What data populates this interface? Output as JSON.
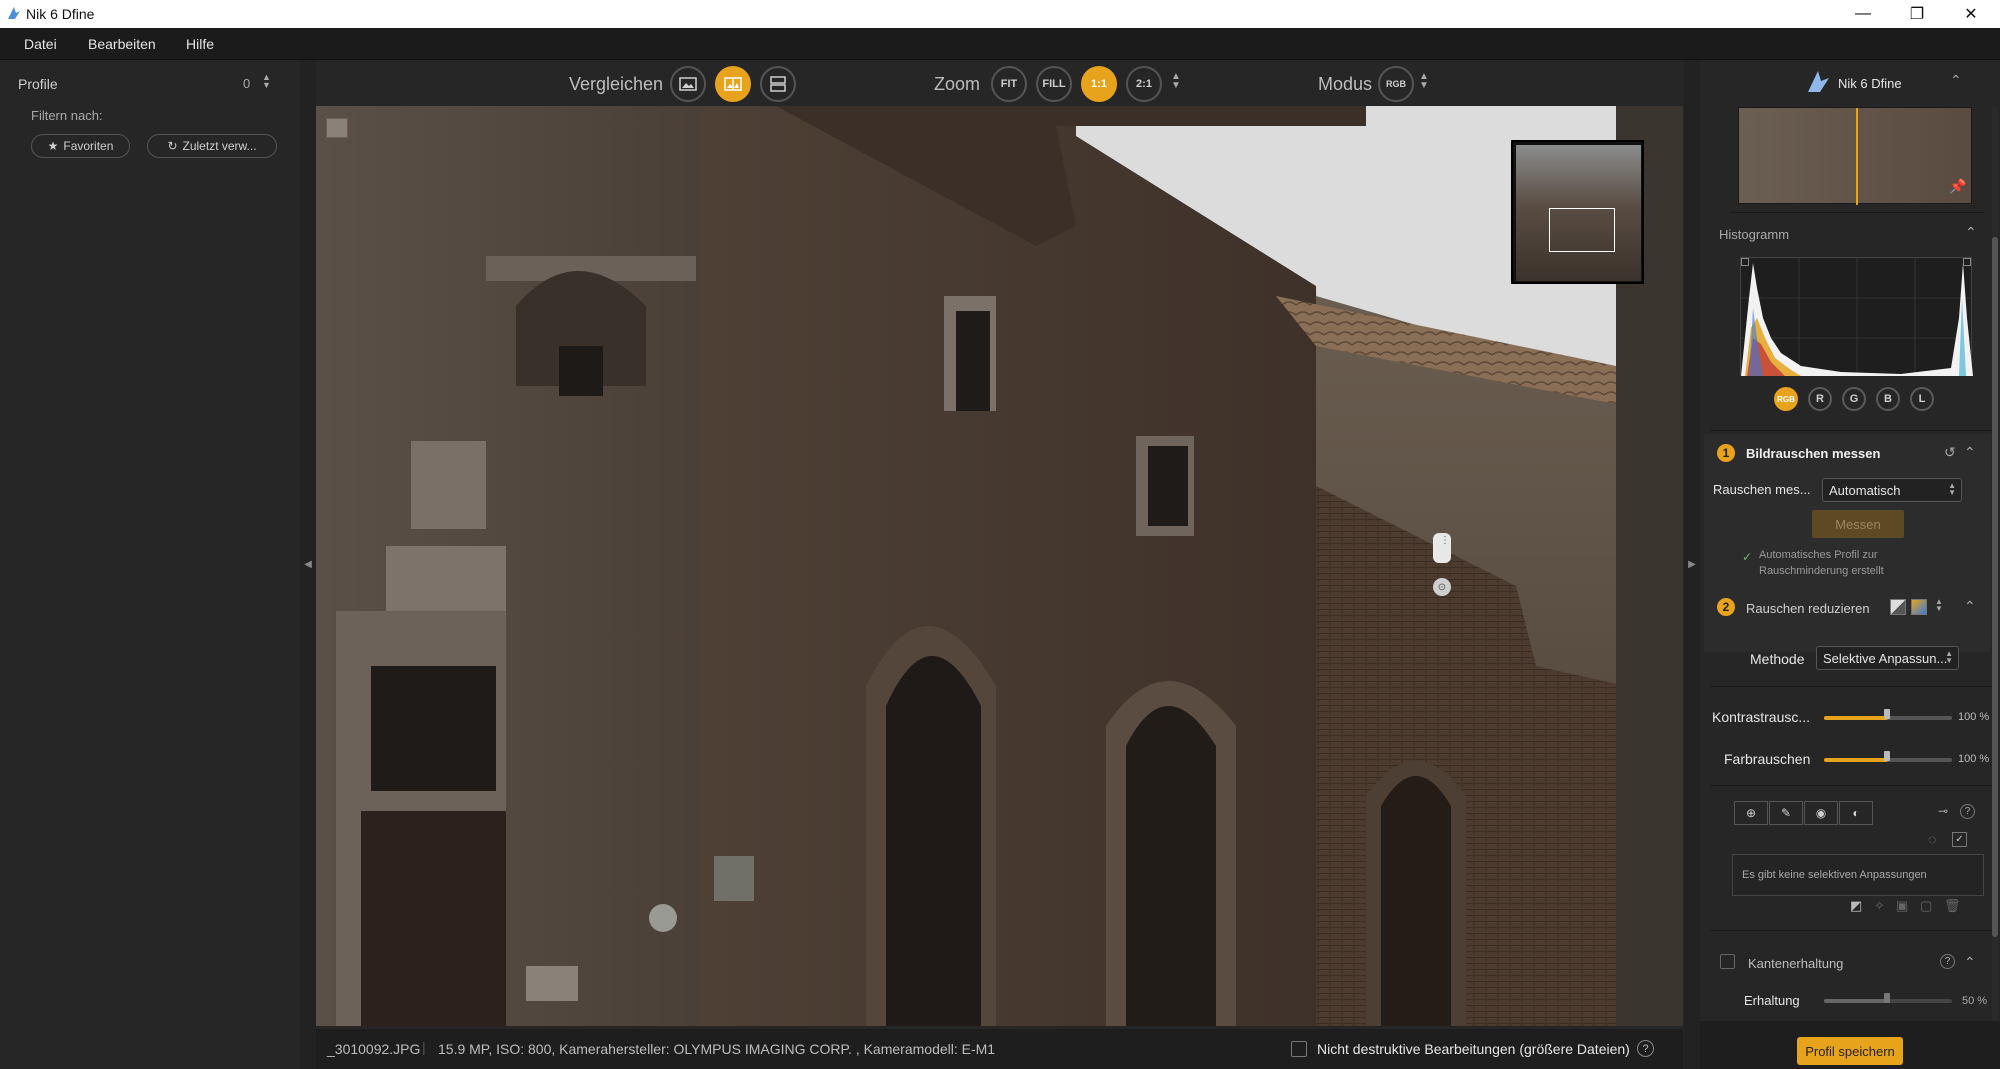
{
  "window": {
    "title": "Nik 6 Dfine",
    "minimize": "—",
    "maximize": "❐",
    "close": "✕"
  },
  "menu": [
    "Datei",
    "Bearbeiten",
    "Hilfe"
  ],
  "left": {
    "profiles_label": "Profile",
    "profiles_count": "0",
    "filter_label": "Filtern nach:",
    "favorites_label": "Favoriten",
    "recent_label": "Zuletzt verw..."
  },
  "toolbar": {
    "compare_label": "Vergleichen",
    "zoom_label": "Zoom",
    "zoom_fit": "FIT",
    "zoom_fill": "FILL",
    "zoom_1_1": "1:1",
    "zoom_2_1": "2:1",
    "mode_label": "Modus",
    "mode_value": "RGB"
  },
  "status": {
    "filename": "_3010092.JPG",
    "info": "15.9 MP, ISO: 800, Kamerahersteller: OLYMPUS IMAGING CORP.  , Kameramodell: E-M1",
    "nondestructive_label": "Nicht destruktive Bearbeitungen (größere Dateien)",
    "help": "?"
  },
  "right": {
    "app_name": "Nik 6 Dfine",
    "histogram_title": "Histogramm",
    "channels": [
      "RGB",
      "R",
      "G",
      "B",
      "L"
    ],
    "step1_num": "1",
    "step1_title": "Bildrauschen messen",
    "noise_measure_label": "Rauschen mes...",
    "noise_measure_value": "Automatisch",
    "measure_button": "Messen",
    "auto_profile_text_1": "Automatisches Profil zur",
    "auto_profile_text_2": "Rauschminderung erstellt",
    "step2_num": "2",
    "step2_title": "Rauschen reduzieren",
    "method_label": "Methode",
    "method_value": "Selektive Anpassun...",
    "contrast_label": "Kontrastrausc...",
    "contrast_value": "100 %",
    "color_label": "Farbrauschen",
    "color_value": "100 %",
    "no_selective": "Es gibt keine selektiven Anpassungen",
    "edge_title": "Kantenerhaltung",
    "preserve_label": "Erhaltung",
    "preserve_value": "50 %",
    "save_profile": "Profil speichern"
  },
  "sliders": {
    "contrast": 100,
    "color": 100,
    "preserve": 50
  },
  "colors": {
    "accent": "#e8a31d",
    "panel": "#262626",
    "titlebar": "#ffffff"
  }
}
